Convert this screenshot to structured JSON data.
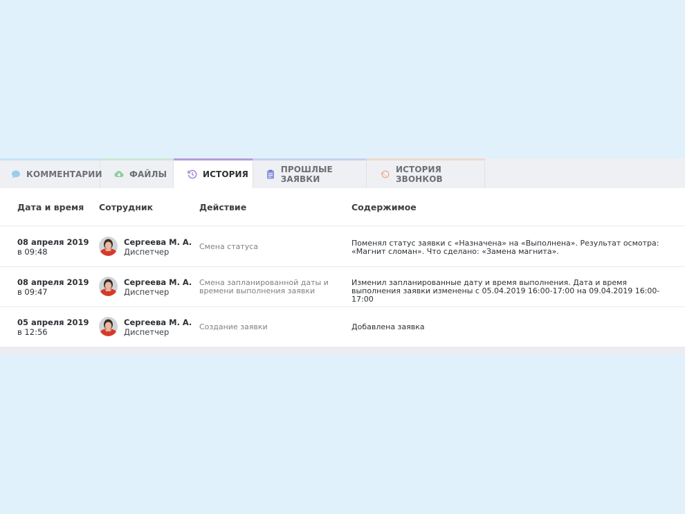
{
  "tabs": [
    {
      "label": "КОММЕНТАРИИ",
      "icon": "comment-icon",
      "accent": "#c6e2f7",
      "icon_color": "#9ccbf0"
    },
    {
      "label": "ФАЙЛЫ",
      "icon": "cloud-download-icon",
      "accent": "#cbe8d5",
      "icon_color": "#8fcca3"
    },
    {
      "label": "ИСТОРИЯ",
      "icon": "history-icon",
      "accent": "#b79cd8",
      "icon_color": "#a88bd2"
    },
    {
      "label": "ПРОШЛЫЕ ЗАЯВКИ",
      "icon": "clipboard-icon",
      "accent": "#c8cfee",
      "icon_color": "#8c97de"
    },
    {
      "label": "ИСТОРИЯ ЗВОНКОВ",
      "icon": "phone-history-icon",
      "accent": "#f4d7c9",
      "icon_color": "#f0a98a"
    }
  ],
  "active_tab": "ИСТОРИЯ",
  "table": {
    "headers": {
      "date": "Дата и время",
      "employee": "Сотрудник",
      "action": "Действие",
      "content": "Содержимое"
    },
    "rows": [
      {
        "date": "08 апреля 2019",
        "time": "в 09:48",
        "name": "Сергеева М. А.",
        "role": "Диспетчер",
        "action": "Смена статуса",
        "content": "Поменял статус заявки с «Назначена» на «Выполнена». Результат осмотра: «Магнит сломан». Что сделано: «Замена магнита»."
      },
      {
        "date": "08 апреля 2019",
        "time": "в 09:47",
        "name": "Сергеева М. А.",
        "role": "Диспетчер",
        "action": "Смена запланированной даты и времени выполнения заявки",
        "content": "Изменил запланированные дату и время выполнения. Дата и время выполнения заявки изменены с 05.04.2019 16:00-17:00 на 09.04.2019 16:00-17:00"
      },
      {
        "date": "05 апреля 2019",
        "time": "в 12:56",
        "name": "Сергеева М. А.",
        "role": "Диспетчер",
        "action": "Создание заявки",
        "content": "Добавлена заявка"
      }
    ]
  }
}
